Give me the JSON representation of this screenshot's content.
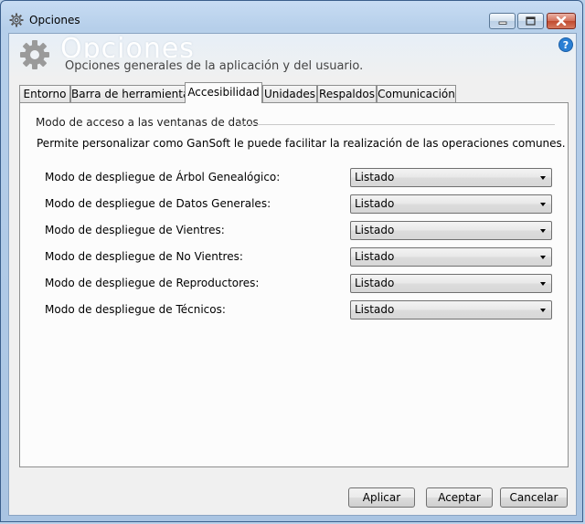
{
  "window": {
    "title": "Opciones",
    "icon": "gear-icon",
    "controls": [
      "minimize-icon",
      "maximize-icon",
      "close-icon"
    ]
  },
  "header": {
    "title": "Opciones",
    "subtitle": "Opciones generales de la aplicación y del usuario.",
    "icon": "gear-icon",
    "help_icon": "help-icon"
  },
  "tabs": [
    {
      "label": "Entorno",
      "active": false
    },
    {
      "label": "Barra de herramientas",
      "active": false
    },
    {
      "label": "Accesibilidad",
      "active": true
    },
    {
      "label": "Unidades",
      "active": false
    },
    {
      "label": "Respaldos",
      "active": false
    },
    {
      "label": "Comunicación",
      "active": false
    }
  ],
  "panel": {
    "group_title": "Modo de acceso a las ventanas de datos",
    "description": "Permite personalizar como GanSoft le puede facilitar la realización de las operaciones comunes.",
    "rows": [
      {
        "label": "Modo de despliegue de Árbol Genealógico:",
        "value": "Listado"
      },
      {
        "label": "Modo de despliegue de Datos Generales:",
        "value": "Listado"
      },
      {
        "label": "Modo de despliegue de Vientres:",
        "value": "Listado"
      },
      {
        "label": "Modo de despliegue de No Vientres:",
        "value": "Listado"
      },
      {
        "label": "Modo de despliegue de Reproductores:",
        "value": "Listado"
      },
      {
        "label": "Modo de despliegue de Técnicos:",
        "value": "Listado"
      }
    ]
  },
  "buttons": {
    "apply": "Aplicar",
    "accept": "Aceptar",
    "cancel": "Cancelar"
  },
  "colors": {
    "frame": "#b6cfea",
    "client": "#f0f0f0",
    "help_blue": "#2a7fd4",
    "close_red": "#c14a2f"
  }
}
